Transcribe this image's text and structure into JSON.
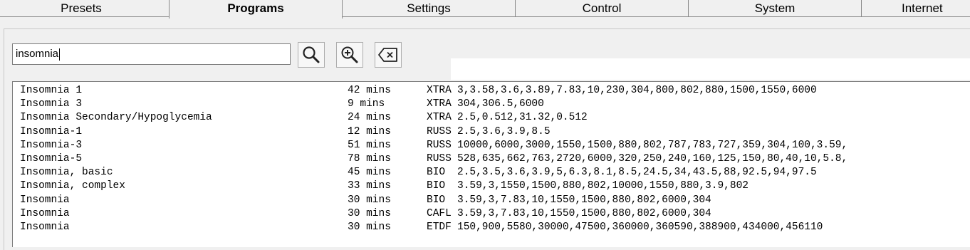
{
  "tabs": [
    {
      "label": "Presets"
    },
    {
      "label": "Programs"
    },
    {
      "label": "Settings"
    },
    {
      "label": "Control"
    },
    {
      "label": "System"
    },
    {
      "label": "Internet"
    }
  ],
  "active_tab": "Programs",
  "search": {
    "value": "insomnia"
  },
  "toolbar": {
    "search_icon": "magnifier-icon",
    "zoom_icon": "zoom-in-icon",
    "clear_icon": "backspace-clear-icon"
  },
  "programs": [
    {
      "name": "Insomnia 1",
      "duration": "42 mins",
      "type": "XTRA",
      "frequencies": "3,3.58,3.6,3.89,7.83,10,230,304,800,802,880,1500,1550,6000"
    },
    {
      "name": "Insomnia 3",
      "duration": "9 mins",
      "type": "XTRA",
      "frequencies": "304,306.5,6000"
    },
    {
      "name": "Insomnia Secondary/Hypoglycemia",
      "duration": "24 mins",
      "type": "XTRA",
      "frequencies": "2.5,0.512,31.32,0.512"
    },
    {
      "name": "Insomnia-1",
      "duration": "12 mins",
      "type": "RUSS",
      "frequencies": "2.5,3.6,3.9,8.5"
    },
    {
      "name": "Insomnia-3",
      "duration": "51 mins",
      "type": "RUSS",
      "frequencies": "10000,6000,3000,1550,1500,880,802,787,783,727,359,304,100,3.59,"
    },
    {
      "name": "Insomnia-5",
      "duration": "78 mins",
      "type": "RUSS",
      "frequencies": "528,635,662,763,2720,6000,320,250,240,160,125,150,80,40,10,5.8,"
    },
    {
      "name": "Insomnia, basic",
      "duration": "45 mins",
      "type": "BIO",
      "frequencies": "2.5,3.5,3.6,3.9,5,6.3,8.1,8.5,24.5,34,43.5,88,92.5,94,97.5"
    },
    {
      "name": "Insomnia, complex",
      "duration": "33 mins",
      "type": "BIO",
      "frequencies": "3.59,3,1550,1500,880,802,10000,1550,880,3.9,802"
    },
    {
      "name": "Insomnia",
      "duration": "30 mins",
      "type": "BIO",
      "frequencies": "3.59,3,7.83,10,1550,1500,880,802,6000,304"
    },
    {
      "name": "Insomnia",
      "duration": "30 mins",
      "type": "CAFL",
      "frequencies": "3.59,3,7.83,10,1550,1500,880,802,6000,304"
    },
    {
      "name": "Insomnia",
      "duration": "30 mins",
      "type": "ETDF",
      "frequencies": "150,900,5580,30000,47500,360000,360590,388900,434000,456110"
    }
  ]
}
